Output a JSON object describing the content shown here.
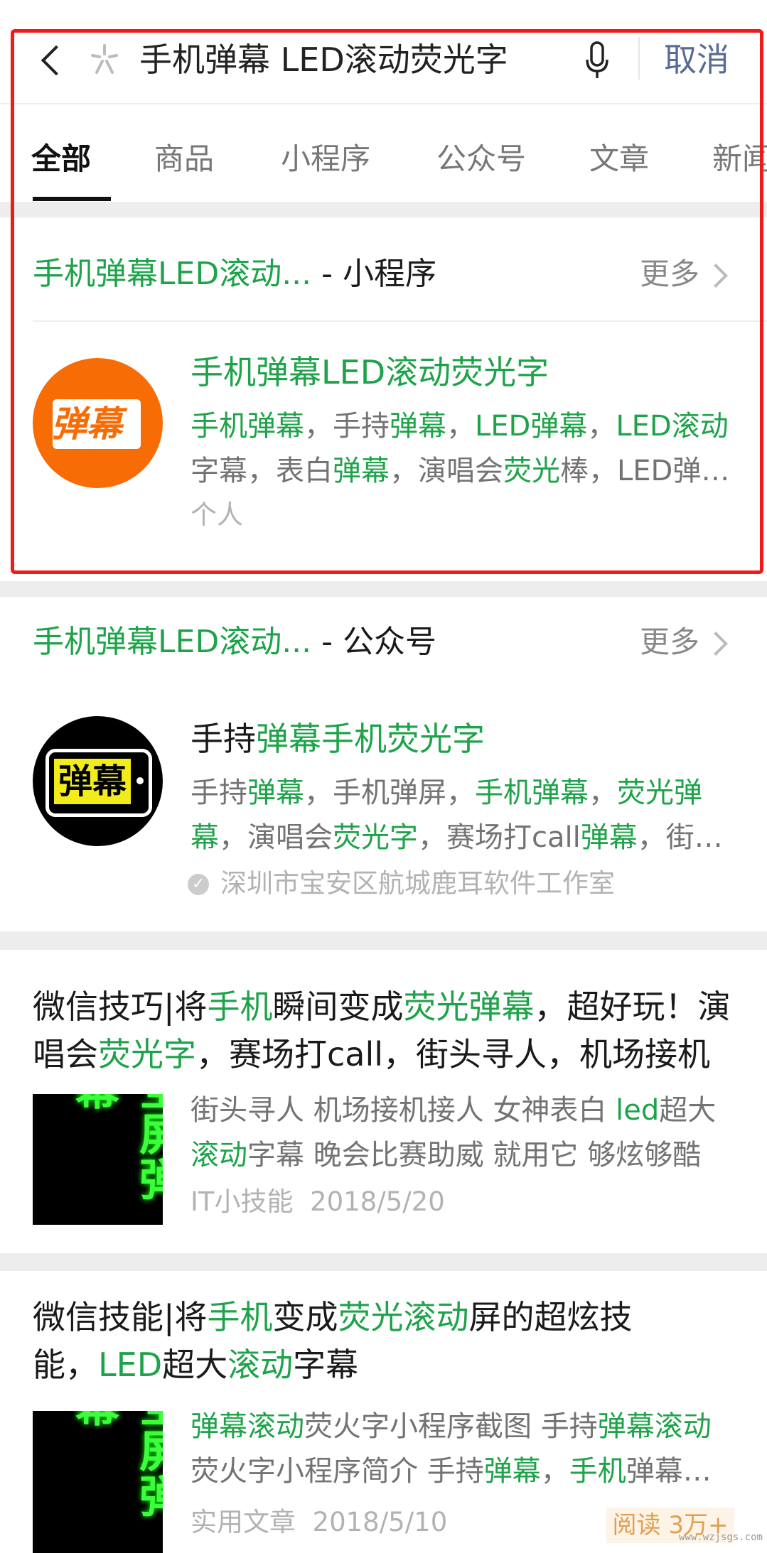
{
  "search": {
    "query": "手机弹幕 LED滚动荧光字",
    "cancel_label": "取消",
    "icons": {
      "back": "chevron-left-icon",
      "search_logo": "spark-icon",
      "voice": "microphone-icon"
    }
  },
  "tabs": [
    {
      "label": "全部",
      "active": true
    },
    {
      "label": "商品"
    },
    {
      "label": "小程序"
    },
    {
      "label": "公众号"
    },
    {
      "label": "文章"
    },
    {
      "label": "新闻"
    }
  ],
  "colors": {
    "highlight": "#1fa34a",
    "cancel": "#576b95",
    "annotation_box": "#f01a1a",
    "read_badge": "#e0a050"
  },
  "mini_program_section": {
    "header_highlight": "手机弹幕LED滚动...",
    "header_suffix": " - 小程序",
    "more_label": "更多",
    "item": {
      "logo_text": "弹幕",
      "title": [
        {
          "t": "手机弹幕LED滚动荧光字",
          "h": true
        }
      ],
      "desc": [
        {
          "t": "手机弹幕",
          "h": true
        },
        {
          "t": "，手持"
        },
        {
          "t": "弹幕",
          "h": true
        },
        {
          "t": "，"
        },
        {
          "t": "LED弹幕",
          "h": true
        },
        {
          "t": "，"
        },
        {
          "t": "LED滚动",
          "h": true
        },
        {
          "t": "字幕，表白"
        },
        {
          "t": "弹幕",
          "h": true
        },
        {
          "t": "，演唱会"
        },
        {
          "t": "荧光",
          "h": true
        },
        {
          "t": "棒，LED弹幕滚动字幕"
        }
      ],
      "owner": "个人"
    }
  },
  "official_account_section": {
    "header_highlight": "手机弹幕LED滚动...",
    "header_suffix": " - 公众号",
    "more_label": "更多",
    "item": {
      "logo_text": "弹幕",
      "title": [
        {
          "t": "手持"
        },
        {
          "t": "弹幕手机荧光字",
          "h": true
        }
      ],
      "desc": [
        {
          "t": "手持"
        },
        {
          "t": "弹幕",
          "h": true
        },
        {
          "t": "，手机弹屏，"
        },
        {
          "t": "手机弹幕",
          "h": true
        },
        {
          "t": "，"
        },
        {
          "t": "荧光弹幕",
          "h": true
        },
        {
          "t": "，演唱会"
        },
        {
          "t": "荧光字",
          "h": true
        },
        {
          "t": "，赛场打call"
        },
        {
          "t": "弹幕",
          "h": true
        },
        {
          "t": "，街头寻人"
        }
      ],
      "verified_by": "深圳市宝安区航城鹿耳软件工作室"
    }
  },
  "articles": [
    {
      "title": [
        {
          "t": "微信技巧|将"
        },
        {
          "t": "手机",
          "h": true
        },
        {
          "t": "瞬间变成"
        },
        {
          "t": "荧光弹幕",
          "h": true
        },
        {
          "t": "，超好玩！演唱会"
        },
        {
          "t": "荧光字",
          "h": true
        },
        {
          "t": "，赛场打call，街头寻人，机场接机"
        }
      ],
      "thumb_text": "全屏弹幕",
      "desc": [
        {
          "t": "街头寻人 机场接机接人 女神表白 "
        },
        {
          "t": "led",
          "h": true
        },
        {
          "t": "超大"
        },
        {
          "t": "滚动",
          "h": true
        },
        {
          "t": "字幕 晚会比赛助威 就用它 够炫够酷"
        }
      ],
      "source": "IT小技能",
      "date": "2018/5/20"
    },
    {
      "title": [
        {
          "t": "微信技能|将"
        },
        {
          "t": "手机",
          "h": true
        },
        {
          "t": "变成"
        },
        {
          "t": "荧光滚动",
          "h": true
        },
        {
          "t": "屏的超炫技能，"
        },
        {
          "t": "LED",
          "h": true
        },
        {
          "t": "超大"
        },
        {
          "t": "滚动",
          "h": true
        },
        {
          "t": "字幕"
        }
      ],
      "thumb_text": "全屏弹幕",
      "desc": [
        {
          "t": "弹幕滚动",
          "h": true
        },
        {
          "t": "荧火字小程序截图 手持"
        },
        {
          "t": "弹幕滚动",
          "h": true
        },
        {
          "t": "荧火字小程序简介 手持"
        },
        {
          "t": "弹幕",
          "h": true
        },
        {
          "t": "，"
        },
        {
          "t": "手机",
          "h": true
        },
        {
          "t": "弹幕滚动"
        }
      ],
      "source": "实用文章",
      "date": "2018/5/10",
      "read_badge": "阅读 3万+"
    }
  ],
  "watermark": "www.wzjsgs.com"
}
